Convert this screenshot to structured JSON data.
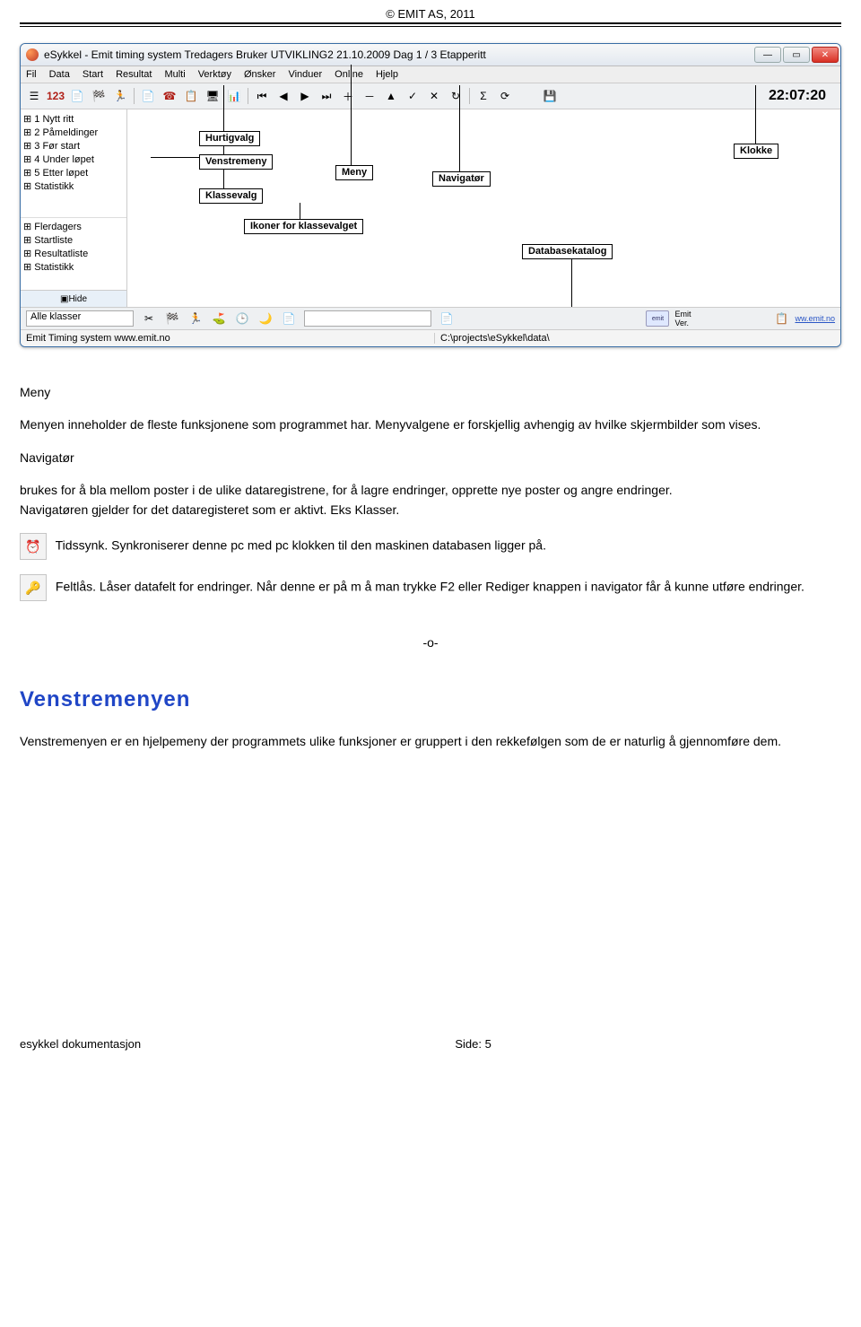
{
  "header": {
    "copyright": "© EMIT AS, 2011"
  },
  "window": {
    "title": "eSykkel - Emit timing system  Tredagers   Bruker UTVIKLING2   21.10.2009   Dag  1 / 3  Etapperitt",
    "menubar": [
      "Fil",
      "Data",
      "Start",
      "Resultat",
      "Multi",
      "Verktøy",
      "Ønsker",
      "Vinduer",
      "Online",
      "Hjelp"
    ],
    "clock": "22:07:20",
    "nav_top": [
      "1 Nytt ritt",
      "2 Påmeldinger",
      "3 Før start",
      "4 Under løpet",
      "5 Etter løpet",
      "Statistikk"
    ],
    "nav_bottom": [
      "Flerdagers",
      "Startliste",
      "Resultatliste",
      "Statistikk"
    ],
    "nav_hide": "Hide",
    "callouts": {
      "hurtigvalg": "Hurtigvalg",
      "venstremeny": "Venstremeny",
      "meny": "Meny",
      "navigator": "Navigatør",
      "klassevalg": "Klassevalg",
      "ikoner": "Ikoner for klassevalget",
      "databasekatalog": "Databasekatalog",
      "klokke": "Klokke"
    },
    "bottom1_label": "Alle klasser",
    "bottom1_emit": "Emit",
    "bottom1_ver": "Ver.",
    "bottom_right_link": "ww.emit.no",
    "statusbar_left": "Emit Timing system www.emit.no",
    "statusbar_right": "C:\\projects\\eSykkel\\data\\"
  },
  "body": {
    "s1_h": "Meny",
    "s1_p": "Menyen inneholder de fleste funksjonene som programmet har. Menyvalgene er forskjellig avhengig av hvilke skjermbilder som vises.",
    "s2_h": "Navigatør",
    "s2_p1": "brukes for å bla mellom poster i de ulike dataregistrene, for å lagre endringer, opprette nye poster og angre endringer.",
    "s2_p2": "Navigatøren gjelder for det dataregisteret som er aktivt. Eks Klasser.",
    "tids_p": "Tidssynk. Synkroniserer  denne pc   med pc klokken til den maskinen databasen ligger på.",
    "felt_p": "Feltlås. Låser datafelt for endringer. Når denne er på m å man trykke F2 eller Rediger knappen i navigator får å kunne utføre endringer.",
    "divider": "-o-",
    "h2": "Venstremenyen",
    "vm_p": "Venstremenyen er en hjelpemeny der programmets ulike funksjoner er gruppert i den rekkefølgen som de er naturlig å gjennomføre dem."
  },
  "footer": {
    "left": "esykkel dokumentasjon",
    "right": "Side: 5"
  }
}
